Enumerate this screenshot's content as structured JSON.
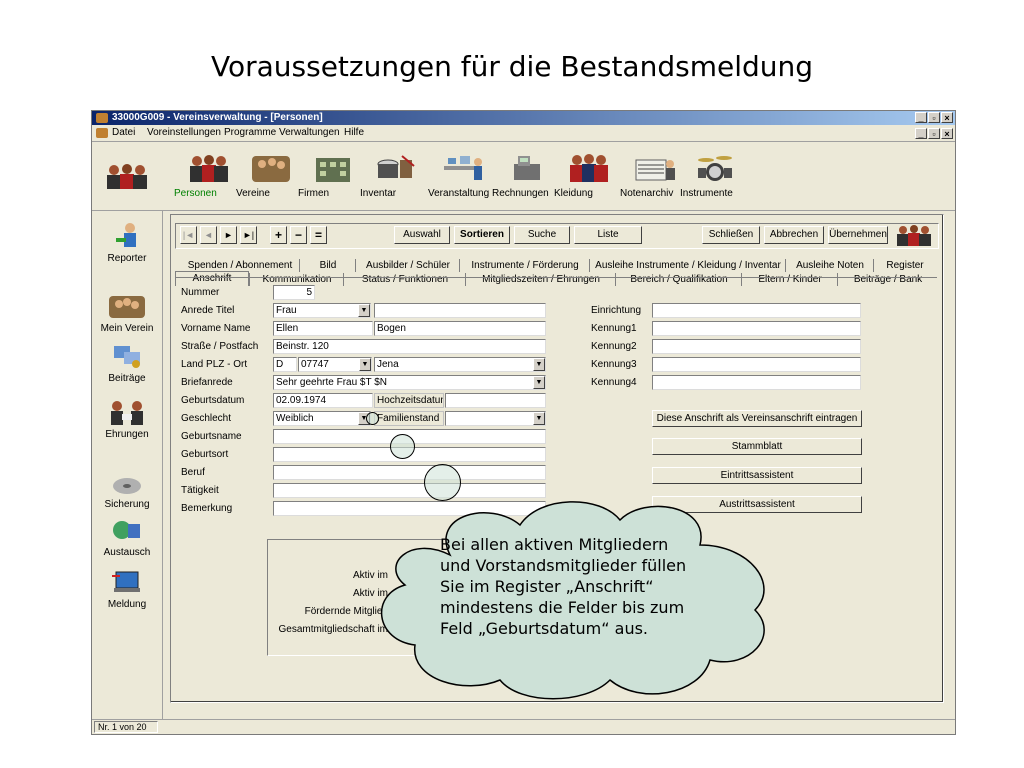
{
  "slide": {
    "title": "Voraussetzungen für die Bestandsmeldung"
  },
  "window": {
    "title": "33000G009 - Vereinsverwaltung - [Personen]",
    "btn_min": "_",
    "btn_max": "▫",
    "btn_close": "×"
  },
  "menu": {
    "items": [
      "Datei",
      "Voreinstellungen",
      "Programme",
      "Verwaltungen",
      "Hilfe"
    ]
  },
  "iconbar": {
    "items": [
      {
        "label": "Personen",
        "icon": "people-icon",
        "active": true
      },
      {
        "label": "Vereine",
        "icon": "group-icon"
      },
      {
        "label": "Firmen",
        "icon": "building-icon"
      },
      {
        "label": "Inventar",
        "icon": "drum-icon"
      },
      {
        "label": "Veranstaltung",
        "icon": "event-icon"
      },
      {
        "label": "Rechnungen",
        "icon": "cash-register-icon"
      },
      {
        "label": "Kleidung",
        "icon": "uniform-icon"
      },
      {
        "label": "Notenarchiv",
        "icon": "sheet-music-icon"
      },
      {
        "label": "Instrumente",
        "icon": "drumkit-icon"
      }
    ]
  },
  "sidebar": {
    "items": [
      {
        "label": "Reporter",
        "icon": "reporter-icon"
      },
      {
        "label": "Mein Verein",
        "icon": "club-icon"
      },
      {
        "label": "Beiträge",
        "icon": "contributions-icon"
      },
      {
        "label": "Ehrungen",
        "icon": "honours-icon"
      },
      {
        "label": "Sicherung",
        "icon": "backup-icon"
      },
      {
        "label": "Austausch",
        "icon": "exchange-icon"
      },
      {
        "label": "Meldung",
        "icon": "report-icon"
      }
    ]
  },
  "toolbar": {
    "first": "|◄",
    "prev": "◄",
    "next": "►",
    "last": "►|",
    "add": "+",
    "remove": "−",
    "equal": "=",
    "auswahl": "Auswahl",
    "sortieren": "Sortieren",
    "suche": "Suche",
    "liste": "Liste",
    "schliessen": "Schließen",
    "abbrechen": "Abbrechen",
    "uebernehmen": "Übernehmen"
  },
  "tabs": {
    "row1": [
      "Spenden / Abonnement",
      "Bild",
      "Ausbilder / Schüler",
      "Instrumente / Förderung",
      "Ausleihe Instrumente / Kleidung / Inventar",
      "Ausleihe Noten",
      "Register"
    ],
    "row2": [
      "Anschrift",
      "Kommunikation",
      "Status / Funktionen",
      "Mitgliedszeiten / Ehrungen",
      "Bereich / Qualifikation",
      "Eltern / Kinder",
      "Beiträge / Bank"
    ]
  },
  "form": {
    "labels": {
      "nummer": "Nummer",
      "anrede": "Anrede Titel",
      "vorname": "Vorname Name",
      "strasse": "Straße / Postfach",
      "land": "Land PLZ - Ort",
      "briefanrede": "Briefanrede",
      "geburtsdatum": "Geburtsdatum",
      "geschlecht": "Geschlecht",
      "geburtsname": "Geburtsname",
      "geburtsort": "Geburtsort",
      "beruf": "Beruf",
      "taetigkeit": "Tätigkeit",
      "bemerkung": "Bemerkung",
      "hochzeitsdatum": "Hochzeitsdatum",
      "familienstand": "Familienstand",
      "einrichtung": "Einrichtung",
      "kennung1": "Kennung1",
      "kennung2": "Kennung2",
      "kennung3": "Kennung3",
      "kennung4": "Kennung4"
    },
    "values": {
      "nummer": "5",
      "anrede": "Frau",
      "titel": "",
      "vorname": "Ellen",
      "name": "Bogen",
      "strasse": "Beinstr. 120",
      "land": "D",
      "plz": "07747",
      "ort": "Jena",
      "briefanrede": "Sehr geehrte Frau $T $N",
      "geburtsdatum": "02.09.1974",
      "geschlecht": "Weiblich"
    },
    "buttons": {
      "vereinsanschrift": "Diese Anschrift als Vereinsanschrift eintragen",
      "stammblatt": "Stammblatt",
      "eintritt": "Eintrittsassistent",
      "austritt": "Austrittsassistent"
    },
    "groupbox": [
      "Aktiv im",
      "Aktiv im",
      "Fördernde Mitglied",
      "Gesamtmitgliedschaft im"
    ]
  },
  "status": {
    "record": "Nr. 1 von 20"
  },
  "callout": {
    "text": "Bei allen aktiven Mitgliedern und Vorstandsmitglieder füllen Sie im Register „Anschrift“ mindestens die Felder bis zum Feld „Geburtsdatum“ aus."
  },
  "colors": {
    "title_bar_start": "#0a246a",
    "title_bar_end": "#a6caf0",
    "cloud_fill": "#cde1d7",
    "active_icon_label": "#008000"
  }
}
